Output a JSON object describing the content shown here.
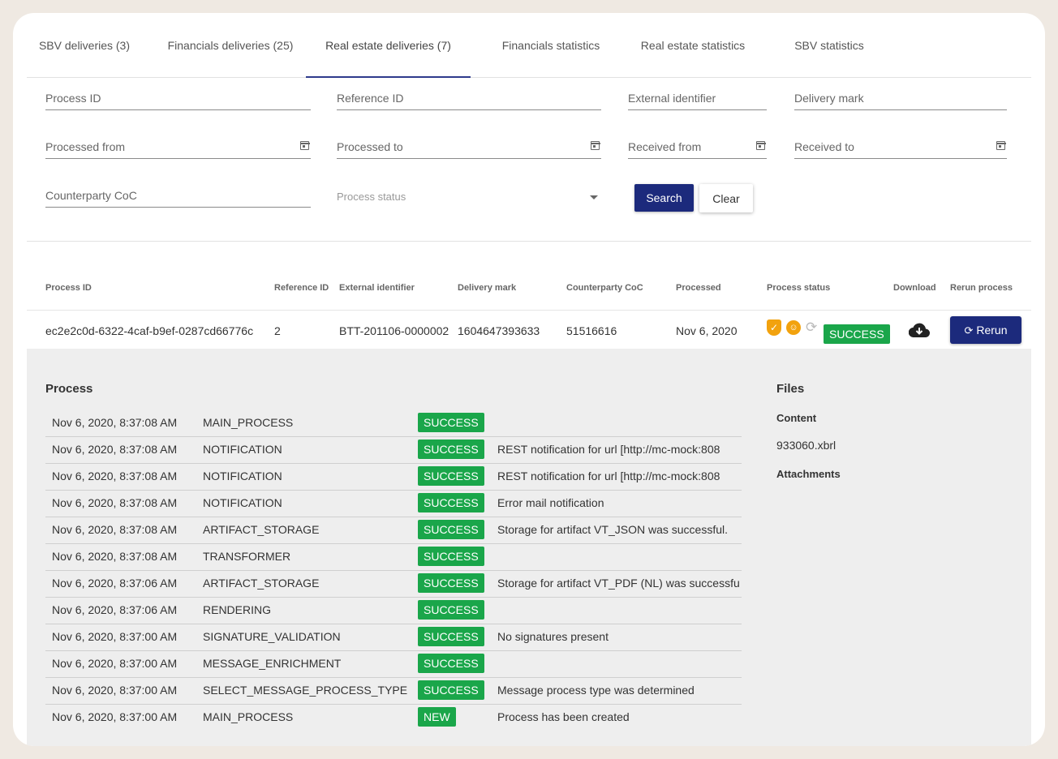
{
  "tabs": [
    {
      "label": "SBV deliveries (3)"
    },
    {
      "label": "Financials deliveries (25)"
    },
    {
      "label": "Real estate deliveries (7)"
    },
    {
      "label": "Financials statistics"
    },
    {
      "label": "Real estate statistics"
    },
    {
      "label": "SBV statistics"
    }
  ],
  "filters": {
    "process_id": "Process ID",
    "reference_id": "Reference ID",
    "external_identifier": "External identifier",
    "delivery_mark": "Delivery mark",
    "processed_from": "Processed from",
    "processed_to": "Processed to",
    "received_from": "Received from",
    "received_to": "Received to",
    "counterparty_coc": "Counterparty CoC",
    "process_status": "Process status",
    "search_label": "Search",
    "clear_label": "Clear"
  },
  "table": {
    "headers": [
      "Process ID",
      "Reference ID",
      "External identifier",
      "Delivery mark",
      "Counterparty CoC",
      "Processed",
      "Process status",
      "Download",
      "Rerun process"
    ],
    "row": {
      "process_id": "ec2e2c0d-6322-4caf-b9ef-0287cd66776c",
      "reference_id": "2",
      "external_identifier": "BTT-201106-0000002",
      "delivery_mark": "1604647393633",
      "counterparty_coc": "51516616",
      "processed": "Nov 6, 2020",
      "status": "SUCCESS",
      "rerun_label": "Rerun"
    }
  },
  "icons": {
    "status_icons": [
      "shield-icon",
      "face-icon",
      "refresh-icon"
    ],
    "download": "cloud-download-icon",
    "rerun": "refresh-icon",
    "calendar": "calendar-icon"
  },
  "colors": {
    "primary": "#1c2a7c",
    "success": "#1aa64a",
    "warning": "#f2a20e"
  },
  "process": {
    "title": "Process",
    "steps": [
      {
        "time": "Nov 6, 2020, 8:37:08 AM",
        "step": "MAIN_PROCESS",
        "status": "SUCCESS",
        "message": ""
      },
      {
        "time": "Nov 6, 2020, 8:37:08 AM",
        "step": "NOTIFICATION",
        "status": "SUCCESS",
        "message": "REST notification for url [http://mc-mock:808"
      },
      {
        "time": "Nov 6, 2020, 8:37:08 AM",
        "step": "NOTIFICATION",
        "status": "SUCCESS",
        "message": "REST notification for url [http://mc-mock:808"
      },
      {
        "time": "Nov 6, 2020, 8:37:08 AM",
        "step": "NOTIFICATION",
        "status": "SUCCESS",
        "message": "Error mail notification"
      },
      {
        "time": "Nov 6, 2020, 8:37:08 AM",
        "step": "ARTIFACT_STORAGE",
        "status": "SUCCESS",
        "message": "Storage for artifact VT_JSON was successful."
      },
      {
        "time": "Nov 6, 2020, 8:37:08 AM",
        "step": "TRANSFORMER",
        "status": "SUCCESS",
        "message": ""
      },
      {
        "time": "Nov 6, 2020, 8:37:06 AM",
        "step": "ARTIFACT_STORAGE",
        "status": "SUCCESS",
        "message": "Storage for artifact VT_PDF (NL) was successful."
      },
      {
        "time": "Nov 6, 2020, 8:37:06 AM",
        "step": "RENDERING",
        "status": "SUCCESS",
        "message": ""
      },
      {
        "time": "Nov 6, 2020, 8:37:00 AM",
        "step": "SIGNATURE_VALIDATION",
        "status": "SUCCESS",
        "message": "No signatures present"
      },
      {
        "time": "Nov 6, 2020, 8:37:00 AM",
        "step": "MESSAGE_ENRICHMENT",
        "status": "SUCCESS",
        "message": ""
      },
      {
        "time": "Nov 6, 2020, 8:37:00 AM",
        "step": "SELECT_MESSAGE_PROCESS_TYPE",
        "status": "SUCCESS",
        "message": "Message process type was determined"
      },
      {
        "time": "Nov 6, 2020, 8:37:00 AM",
        "step": "MAIN_PROCESS",
        "status": "NEW",
        "message": "Process has been created"
      }
    ]
  },
  "files": {
    "title": "Files",
    "content_label": "Content",
    "content_file": "933060.xbrl",
    "attachments_label": "Attachments"
  }
}
